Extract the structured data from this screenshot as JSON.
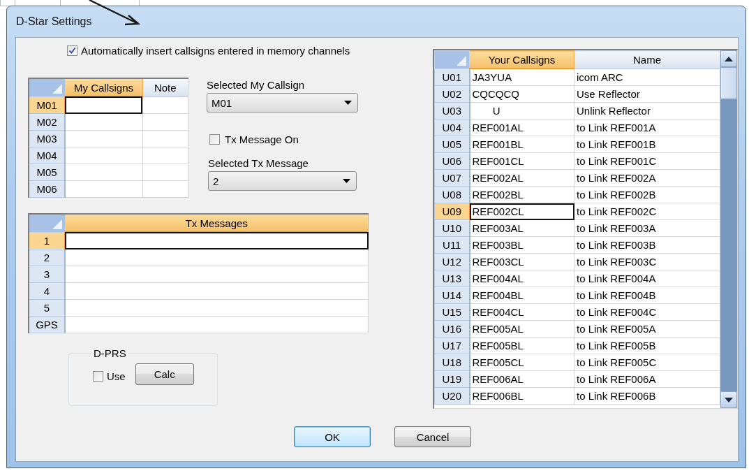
{
  "window": {
    "title": "D-Star Settings"
  },
  "auto_insert": {
    "label": "Automatically insert callsigns entered in memory channels",
    "checked": true
  },
  "my_callsigns": {
    "columns": [
      {
        "label": "My Callsigns",
        "selected": true
      },
      {
        "label": "Note",
        "selected": false
      }
    ],
    "rows": [
      {
        "header": "M01",
        "selected": true
      },
      {
        "header": "M02",
        "selected": false
      },
      {
        "header": "M03",
        "selected": false
      },
      {
        "header": "M04",
        "selected": false
      },
      {
        "header": "M05",
        "selected": false
      },
      {
        "header": "M06",
        "selected": false
      }
    ]
  },
  "selected_my_callsign": {
    "label": "Selected My Callsign",
    "value": "M01"
  },
  "tx_message_on": {
    "label": "Tx Message On",
    "checked": false
  },
  "selected_tx_message": {
    "label": "Selected Tx Message",
    "value": "2"
  },
  "tx_messages": {
    "columns": [
      {
        "label": "Tx Messages",
        "selected": true
      }
    ],
    "rows": [
      {
        "header": "1",
        "selected": true
      },
      {
        "header": "2",
        "selected": false
      },
      {
        "header": "3",
        "selected": false
      },
      {
        "header": "4",
        "selected": false
      },
      {
        "header": "5",
        "selected": false
      },
      {
        "header": "GPS",
        "selected": false
      }
    ]
  },
  "dprs": {
    "title": "D-PRS",
    "use": {
      "label": "Use",
      "checked": false
    },
    "calc_button": "Calc"
  },
  "your_callsigns": {
    "columns": [
      {
        "label": "Your Callsigns",
        "selected": true
      },
      {
        "label": "Name",
        "selected": false
      }
    ],
    "rows": [
      {
        "header": "U01",
        "callsign": "JA3YUA",
        "name": "icom ARC",
        "selected": false
      },
      {
        "header": "U02",
        "callsign": "CQCQCQ",
        "name": "Use Reflector",
        "selected": false
      },
      {
        "header": "U03",
        "callsign": "       U",
        "name": "Unlink Reflector",
        "selected": false
      },
      {
        "header": "U04",
        "callsign": "REF001AL",
        "name": "to Link REF001A",
        "selected": false
      },
      {
        "header": "U05",
        "callsign": "REF001BL",
        "name": "to Link REF001B",
        "selected": false
      },
      {
        "header": "U06",
        "callsign": "REF001CL",
        "name": "to Link REF001C",
        "selected": false
      },
      {
        "header": "U07",
        "callsign": "REF002AL",
        "name": "to Link REF002A",
        "selected": false
      },
      {
        "header": "U08",
        "callsign": "REF002BL",
        "name": "to Link REF002B",
        "selected": false
      },
      {
        "header": "U09",
        "callsign": "REF002CL",
        "name": "to Link REF002C",
        "selected": true
      },
      {
        "header": "U10",
        "callsign": "REF003AL",
        "name": "to Link REF003A",
        "selected": false
      },
      {
        "header": "U11",
        "callsign": "REF003BL",
        "name": "to Link REF003B",
        "selected": false
      },
      {
        "header": "U12",
        "callsign": "REF003CL",
        "name": "to Link REF003C",
        "selected": false
      },
      {
        "header": "U13",
        "callsign": "REF004AL",
        "name": "to Link REF004A",
        "selected": false
      },
      {
        "header": "U14",
        "callsign": "REF004BL",
        "name": "to Link REF004B",
        "selected": false
      },
      {
        "header": "U15",
        "callsign": "REF004CL",
        "name": "to Link REF004C",
        "selected": false
      },
      {
        "header": "U16",
        "callsign": "REF005AL",
        "name": "to Link REF005A",
        "selected": false
      },
      {
        "header": "U17",
        "callsign": "REF005BL",
        "name": "to Link REF005B",
        "selected": false
      },
      {
        "header": "U18",
        "callsign": "REF005CL",
        "name": "to Link REF005C",
        "selected": false
      },
      {
        "header": "U19",
        "callsign": "REF006AL",
        "name": "to Link REF006A",
        "selected": false
      },
      {
        "header": "U20",
        "callsign": "REF006BL",
        "name": "to Link REF006B",
        "selected": false
      }
    ]
  },
  "buttons": [
    {
      "label": "OK",
      "default": true
    },
    {
      "label": "Cancel",
      "default": false
    }
  ]
}
